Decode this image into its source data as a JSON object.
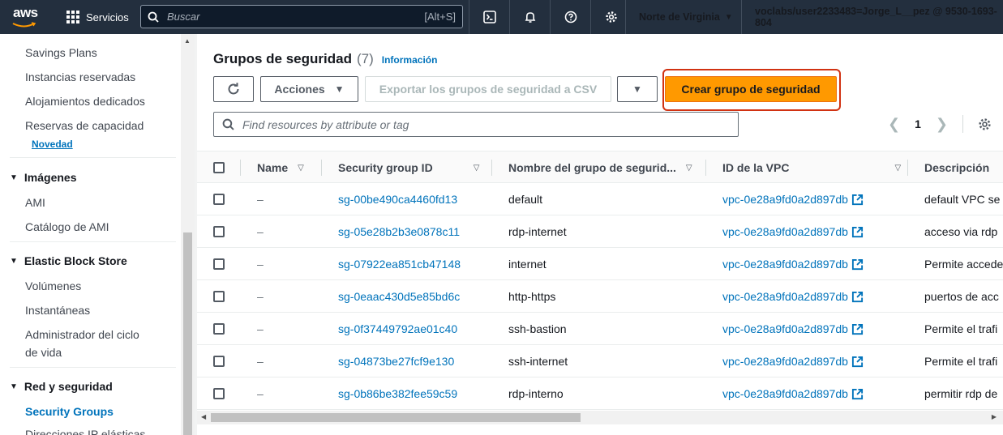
{
  "topnav": {
    "logo": "aws",
    "services_label": "Servicios",
    "search_placeholder": "Buscar",
    "search_shortcut": "[Alt+S]",
    "icons": [
      "cloudshell-icon",
      "bell-icon",
      "help-icon",
      "gear-icon"
    ],
    "region_label": "Norte de Virginia",
    "account_label": "voclabs/user2233483=Jorge_L__pez @ 9530-1693-804"
  },
  "sidebar": {
    "items": [
      {
        "label": "Savings Plans"
      },
      {
        "label": "Instancias reservadas"
      },
      {
        "label": "Alojamientos dedicados"
      },
      {
        "label": "Reservas de capacidad"
      }
    ],
    "badge_new": "Novedad",
    "sections": [
      {
        "title": "Imágenes",
        "items": [
          "AMI",
          "Catálogo de AMI"
        ]
      },
      {
        "title": "Elastic Block Store",
        "items": [
          "Volúmenes",
          "Instantáneas",
          "Administrador del ciclo",
          "de vida"
        ]
      },
      {
        "title": "Red y seguridad",
        "items": [
          "Security Groups",
          "Direcciones IP elásticas"
        ]
      }
    ]
  },
  "main": {
    "title": "Grupos de seguridad",
    "count": "(7)",
    "info_link": "Información",
    "buttons": {
      "actions": "Acciones",
      "export": "Exportar los grupos de seguridad a CSV",
      "create": "Crear grupo de seguridad"
    },
    "filter_placeholder": "Find resources by attribute or tag",
    "pagination": {
      "current_page": "1"
    },
    "colors": {
      "accent": "#0073bb",
      "primary_button": "#ff9900",
      "highlight": "#d13212"
    },
    "table": {
      "columns": [
        "Name",
        "Security group ID",
        "Nombre del grupo de segurid...",
        "ID de la VPC",
        "Descripción"
      ],
      "rows": [
        {
          "name": "–",
          "sg_id": "sg-00be490ca4460fd13",
          "group_name": "default",
          "vpc_id": "vpc-0e28a9fd0a2d897db",
          "description": "default VPC se"
        },
        {
          "name": "–",
          "sg_id": "sg-05e28b2b3e0878c11",
          "group_name": "rdp-internet",
          "vpc_id": "vpc-0e28a9fd0a2d897db",
          "description": "acceso via rdp"
        },
        {
          "name": "–",
          "sg_id": "sg-07922ea851cb47148",
          "group_name": "internet",
          "vpc_id": "vpc-0e28a9fd0a2d897db",
          "description": "Permite accede"
        },
        {
          "name": "–",
          "sg_id": "sg-0eaac430d5e85bd6c",
          "group_name": "http-https",
          "vpc_id": "vpc-0e28a9fd0a2d897db",
          "description": "puertos de acc"
        },
        {
          "name": "–",
          "sg_id": "sg-0f37449792ae01c40",
          "group_name": "ssh-bastion",
          "vpc_id": "vpc-0e28a9fd0a2d897db",
          "description": "Permite el trafi"
        },
        {
          "name": "–",
          "sg_id": "sg-04873be27fcf9e130",
          "group_name": "ssh-internet",
          "vpc_id": "vpc-0e28a9fd0a2d897db",
          "description": "Permite el trafi"
        },
        {
          "name": "–",
          "sg_id": "sg-0b86be382fee59c59",
          "group_name": "rdp-interno",
          "vpc_id": "vpc-0e28a9fd0a2d897db",
          "description": "permitir rdp de"
        }
      ]
    }
  }
}
